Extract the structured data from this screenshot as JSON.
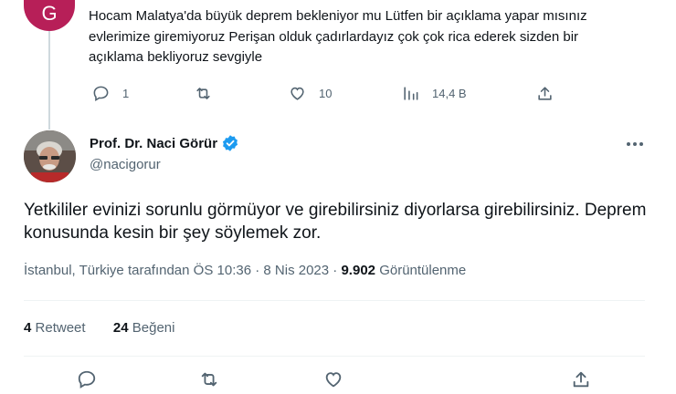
{
  "reply": {
    "avatar_letter": "G",
    "avatar_color": "#b71f58",
    "text": "Hocam Malatya'da büyük deprem bekleniyor mu Lütfen bir açıklama yapar mısınız evlerimize giremiyoruz Perişan olduk çadırlardayız çok çok rica ederek sizden bir açıklama bekliyoruz sevgiyle",
    "actions": {
      "reply_count": "1",
      "retweet_count": "",
      "like_count": "10",
      "views_count": "14,4 B"
    }
  },
  "tweet": {
    "author_name": "Prof. Dr. Naci Görür",
    "handle": "@nacigorur",
    "verified_color": "#1d9bf0",
    "text": "Yetkililer evinizi sorunlu görmüyor ve girebilirsiniz diyorlarsa girebilirsiniz. Deprem konusunda kesin bir şey söylemek zor.",
    "location": "İstanbul, Türkiye tarafından",
    "time": "ÖS 10:36",
    "separator": "·",
    "date": "8 Nis 2023",
    "views_number": "9.902",
    "views_label": "Görüntülenme",
    "retweets_number": "4",
    "retweets_label": "Retweet",
    "likes_number": "24",
    "likes_label": "Beğeni"
  },
  "icons": {
    "reply": "comment-icon",
    "retweet": "retweet-icon",
    "like": "heart-icon",
    "views": "analytics-icon",
    "share": "share-icon",
    "more": "more-icon",
    "verified": "verified-badge-icon"
  }
}
